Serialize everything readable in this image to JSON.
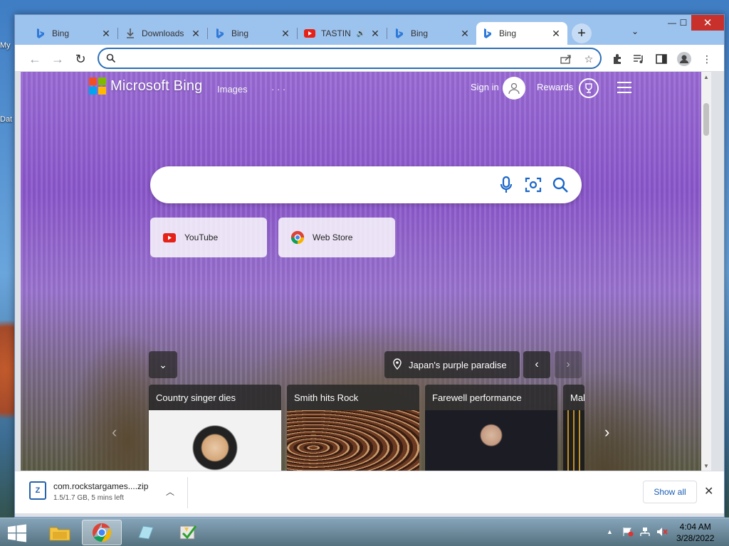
{
  "desktop": {
    "icon_labels": [
      "My",
      "Dat"
    ]
  },
  "tabs": [
    {
      "title": "Bing",
      "favicon": "bing-icon",
      "close": "✕"
    },
    {
      "title": "Downloads",
      "favicon": "download-icon",
      "close": "✕"
    },
    {
      "title": "Bing",
      "favicon": "bing-icon",
      "close": "✕"
    },
    {
      "title": "TASTIN",
      "favicon": "youtube-icon",
      "close": "✕",
      "audio": "🔊"
    },
    {
      "title": "Bing",
      "favicon": "bing-icon",
      "close": "✕"
    },
    {
      "title": "Bing",
      "favicon": "bing-icon",
      "close": "✕",
      "active": true
    }
  ],
  "window_controls": {
    "minimize": "—",
    "maximize": "☐",
    "close": "✕"
  },
  "toolbar": {
    "back": "←",
    "forward": "→",
    "reload": "↻",
    "omnibox_value": ""
  },
  "bing": {
    "brand": "Microsoft Bing",
    "nav_images": "Images",
    "nav_more": "· · ·",
    "sign_in": "Sign in",
    "rewards": "Rewards",
    "quicklinks": [
      {
        "label": "YouTube",
        "icon": "youtube-icon"
      },
      {
        "label": "Web Store",
        "icon": "chrome-web-store-icon"
      }
    ],
    "location": "Japan's purple paradise",
    "news": [
      {
        "headline": "Country singer dies"
      },
      {
        "headline": "Smith hits Rock"
      },
      {
        "headline": "Farewell performance"
      },
      {
        "headline": "Mal"
      }
    ]
  },
  "downloads": {
    "filename": "com.rockstargames....zip",
    "status": "1.5/1.7 GB, 5 mins left",
    "show_all": "Show all"
  },
  "taskbar": {
    "time": "4:04 AM",
    "date": "3/28/2022"
  },
  "colors": {
    "titlebar": "#9cc2ee",
    "omnibox_border": "#2b6fb7",
    "ms_red": "#f25022",
    "ms_green": "#7fba00",
    "ms_blue": "#00a4ef",
    "ms_yellow": "#ffb900"
  }
}
